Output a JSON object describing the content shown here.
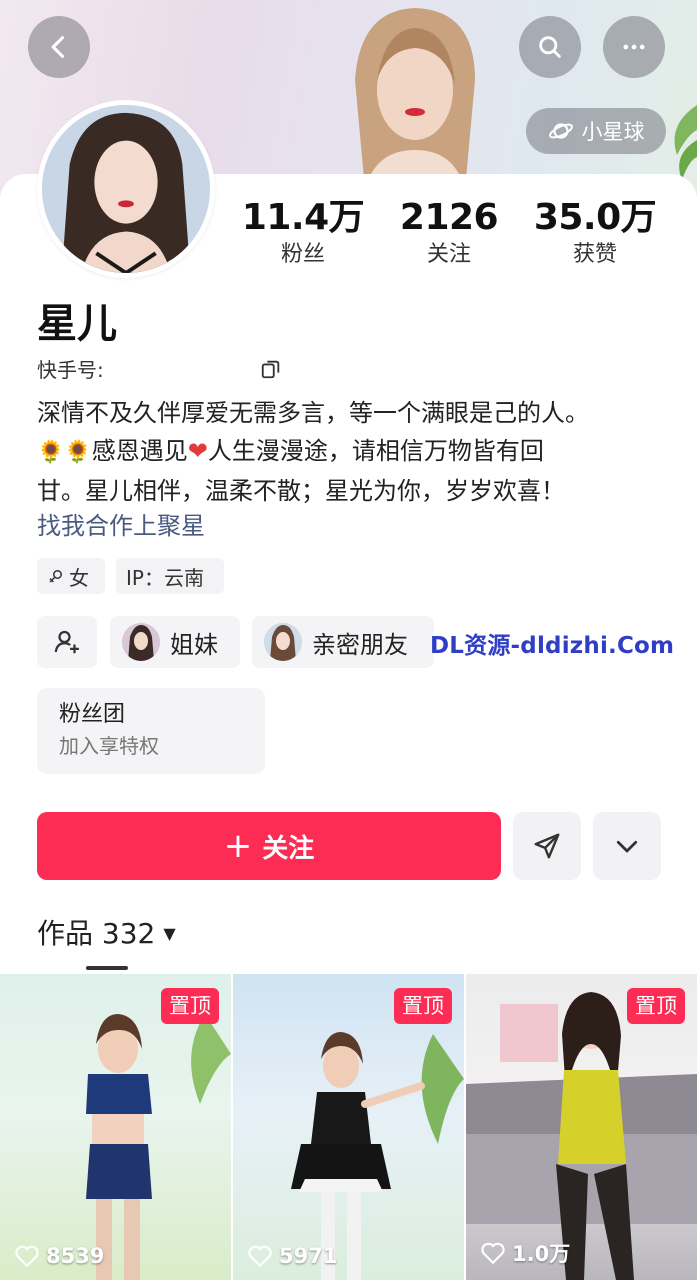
{
  "header": {
    "back_icon": "back-arrow-icon",
    "search_icon": "search-icon",
    "more_icon": "more-dots-icon",
    "planet_chip_label": "小星球"
  },
  "profile": {
    "name": "星儿",
    "kuaishou_id_label": "快手号:",
    "stats": [
      {
        "value": "11.4万",
        "label": "粉丝"
      },
      {
        "value": "2126",
        "label": "关注"
      },
      {
        "value": "35.0万",
        "label": "获赞"
      }
    ],
    "bio_line1": "深情不及久伴厚爱无需多言，等一个满眼是己的人。",
    "bio_line2_emoji": "🌻🌻",
    "bio_line2_text_a": "感恩遇见",
    "bio_line2_heart": "❤",
    "bio_line2_text_b": "人生漫漫途，请相信万物皆有回",
    "bio_line3": "甘。星儿相伴，温柔不散；星光为你，岁岁欢喜！",
    "cooperation_link": "找我合作上聚星",
    "tags": {
      "gender": "女",
      "ip": "IP：云南"
    },
    "relations": {
      "sister": "姐妹",
      "close_friend": "亲密朋友"
    },
    "watermark_brand": "DL资源-dldizhi.Com"
  },
  "fan_club": {
    "title": "粉丝团",
    "subtitle": "加入享特权"
  },
  "actions": {
    "follow_label": "关注",
    "follow_plus": "+"
  },
  "works": {
    "tab_label": "作品 332",
    "items": [
      {
        "pin_label": "置顶",
        "likes": "8539"
      },
      {
        "pin_label": "置顶",
        "likes": "5971"
      },
      {
        "pin_label": "置顶",
        "likes": "1.0万"
      }
    ]
  },
  "colors": {
    "accent": "#fc2c54",
    "link": "#4a5a80",
    "brand_watermark": "#2f3ec5"
  }
}
